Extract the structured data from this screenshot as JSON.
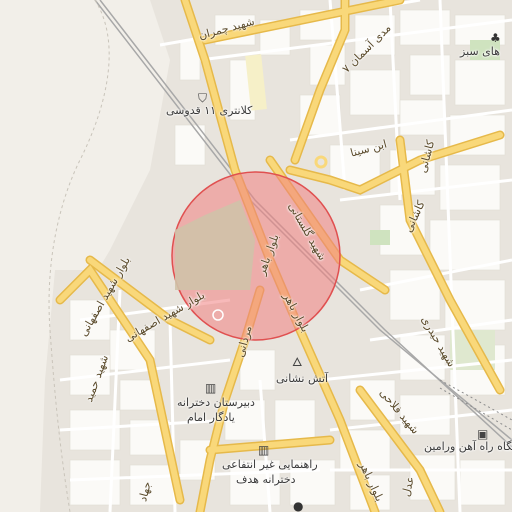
{
  "map": {
    "colors": {
      "land": "#f2efe9",
      "urban": "#e8e4dd",
      "block": "#fbfaf7",
      "minor_road": "#ffffff",
      "major_road": "#f9d87a",
      "major_road_casing": "#e6b94a",
      "rail": "#b0b0b0",
      "circle_fill": "#f08080",
      "circle_stroke": "#e05050",
      "green": "#cfe3bf",
      "campus": "#cfc2a8",
      "water": "#7ab3e0"
    },
    "labels": {
      "shahid_chamran": "شهید چمران",
      "haft_madi_aseman": "۷ مدی آسمان",
      "kalantari_11_qodusi": "کلانتری ۱۱ قدوسی",
      "ibn_sina": "ابن سینا",
      "bahar_sabz": "های سبز",
      "shahid_golestani": "شهید گلستانی",
      "bolvar_baher": "بلوار باهر",
      "bolvar_baher_2": "بلوار باهر",
      "bolvar_baher_3": "بلوار باهر",
      "mardani": "مردانی",
      "bolvar_shahid_esfahani": "بلوار شهید اصفهانی",
      "bolvar_shahid_esfahani_2": "بلوار شهید اصفهانی",
      "shahid_hamid": "شهید حمید",
      "atash_neshani": "آتش نشانی",
      "dabirestan_1": "دبیرستان دخترانه",
      "dabirestan_2": "یادگار امام",
      "rahnamayi_1": "راهنمایی غیر انتفاعی",
      "rahnamayi_2": "دخترانه هدف",
      "rah_ahan_varamin_1": "ایستگاه راه آهن ورامین",
      "shahid_heydari": "شهید حیدری",
      "shahid_falahi": "شهید فلاحی",
      "kashani": "کاشانی",
      "kashani_2": "کاشانی",
      "adl": "عدل",
      "jahad": "جهاد"
    },
    "icons": {
      "police": "police-station-icon",
      "fire": "fire-station-icon",
      "school1": "school-icon",
      "school2": "school-icon",
      "rail_station": "rail-station-icon",
      "park": "tree-icon"
    }
  }
}
